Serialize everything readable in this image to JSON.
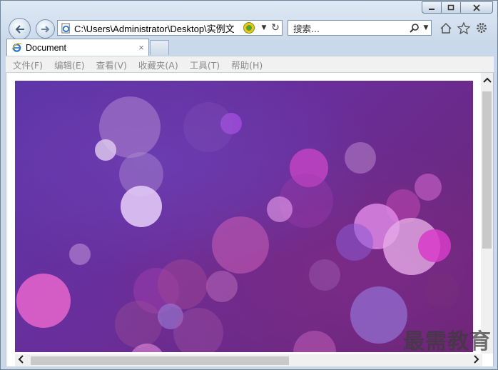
{
  "window": {
    "minimize_icon": "minimize-icon",
    "maximize_icon": "maximize-icon",
    "close_icon": "close-icon"
  },
  "address_bar": {
    "url": "C:\\Users\\Administrator\\Desktop\\实例文"
  },
  "search": {
    "placeholder": "搜索..."
  },
  "tab": {
    "title": "Document",
    "close": "×"
  },
  "menu": {
    "items": [
      "文件(F)",
      "编辑(E)",
      "查看(V)",
      "收藏夹(A)",
      "工具(T)",
      "帮助(H)"
    ]
  },
  "watermark": "最需教育",
  "colors": {
    "accent": "#3c7fc4",
    "background_top": "#5b35a8",
    "background_bottom": "#6a246f"
  }
}
